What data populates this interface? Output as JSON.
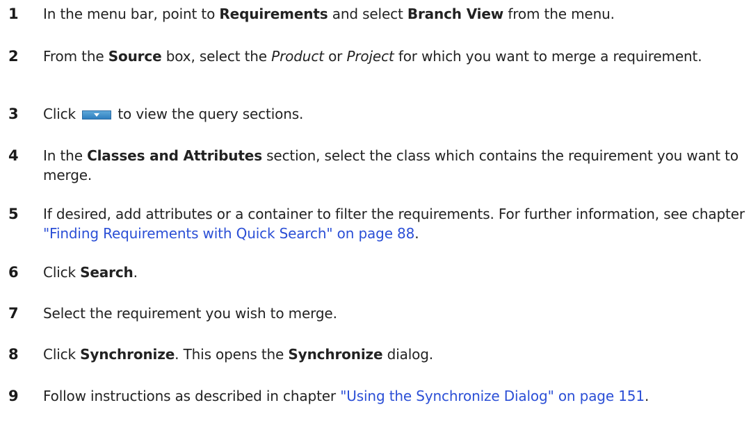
{
  "steps": [
    {
      "num": "1",
      "parts": [
        "In the menu bar, point to ",
        "Requirements",
        " and select ",
        "Branch View",
        " from the menu."
      ]
    },
    {
      "num": "2",
      "parts": [
        "From the ",
        "Source",
        " box, select the ",
        "Product",
        " or ",
        "Project",
        " for which you want to merge a requirement."
      ]
    },
    {
      "num": "3",
      "parts": [
        "Click ",
        " to view the query sections."
      ],
      "icon": "dropdown-expand-icon"
    },
    {
      "num": "4",
      "parts": [
        "In the ",
        "Classes and Attributes",
        " section, select the class which contains the requirement you want to merge."
      ]
    },
    {
      "num": "5",
      "parts": [
        "If desired, add attributes or a container to filter the requirements. For further information, see chapter ",
        "\"Finding Requirements with Quick Search\" on page 88",
        "."
      ]
    },
    {
      "num": "6",
      "parts": [
        "Click ",
        "Search",
        "."
      ]
    },
    {
      "num": "7",
      "parts": [
        "Select the requirement you wish to merge."
      ]
    },
    {
      "num": "8",
      "parts": [
        "Click ",
        "Synchronize",
        ". This opens the ",
        "Synchronize",
        " dialog."
      ]
    },
    {
      "num": "9",
      "parts": [
        "Follow instructions as described in chapter ",
        "\"Using the Synchronize Dialog\" on page 151",
        "."
      ]
    }
  ],
  "colors": {
    "text": "#222222",
    "link": "#2b4fd6",
    "icon": "#2f7fbf"
  }
}
